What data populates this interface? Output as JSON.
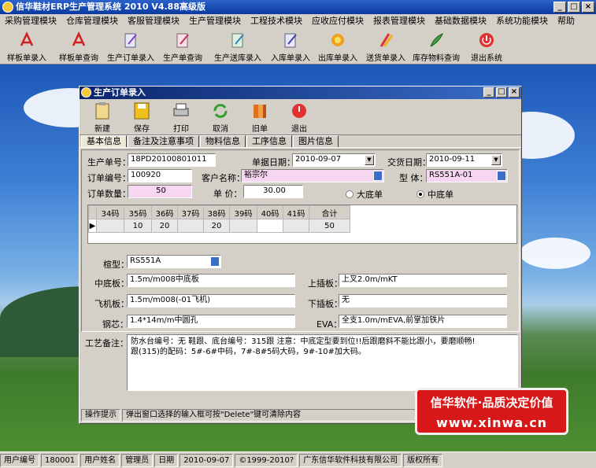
{
  "window": {
    "title": "信华鞋材ERP生产管理系统   2010  V4.88高级版"
  },
  "menu": [
    "采购管理模块",
    "仓库管理模块",
    "客服管理模块",
    "生产管理模块",
    "工程技术模块",
    "应收应付模块",
    "报表管理模块",
    "基础数据模块",
    "系统功能模块",
    "帮助"
  ],
  "toolbar": [
    "样板单录入",
    "样板单查询",
    "生产订单录入",
    "生产单查询",
    "生产送库录入",
    "入库单录入",
    "出库单录入",
    "送货单录入",
    "库存物料查询",
    "退出系统"
  ],
  "child": {
    "title": "生产订单录入",
    "toolbar": [
      "新建",
      "保存",
      "打印",
      "取消",
      "旧单",
      "退出"
    ],
    "tabs": [
      "基本信息",
      "备注及注意事项",
      "物料信息",
      "工序信息",
      "图片信息"
    ],
    "form": {
      "prod_no_label": "生产单号：",
      "prod_no": "18PD20100801011",
      "doc_date_label": "单据日期：",
      "doc_date": "2010-09-07",
      "delivery_label": "交货日期：",
      "delivery": "2010-09-11",
      "order_no_label": "订单编号：",
      "order_no": "100920",
      "customer_label": "客户名称：",
      "customer": "裕宗尔",
      "model_label": "型  体：",
      "model": "RS551A-01",
      "qty_label": "订单数量：",
      "qty": "50",
      "price_label": "单  价：",
      "price": "30.00",
      "radio1": "大底单",
      "radio2": "中底单"
    },
    "grid": {
      "headers": [
        "34码",
        "35码",
        "36码",
        "37码",
        "38码",
        "39码",
        "40码",
        "41码",
        "合计"
      ],
      "row": [
        "",
        "10",
        "20",
        "",
        "20",
        "",
        "",
        "",
        "50"
      ]
    },
    "detail": {
      "last_label": "楦型：",
      "last": "RS551A",
      "mid_label": "中底板：",
      "mid": "1.5m/m008中底板",
      "upper_label": "上插板：",
      "upper": "上叉2.0m/mKT",
      "fly_label": "飞机板：",
      "fly": "1.5m/m008(-01飞机)",
      "lower_label": "下插板：",
      "lower": "无",
      "steel_label": "钢芯：",
      "steel": "1.4*14m/m中圆孔",
      "eva_label": "EVA：",
      "eva": "全支1.0m/mEVA,前掌加铁片",
      "process_label": "工艺备注：",
      "process_line1": "防水台编号：无  鞋跟、底台编号：315跟  注意：中底定型要到位!!后跟磨斜不能比跟小，要磨顺畅!",
      "process_line2": "     跟(315)的配码：5#-6#中码，7#-8#5码大码，9#-10#加大码。"
    },
    "hint_label": "操作提示",
    "hint_text": "弹出窗口选择的输入框可按\"Delete\"键可清除内容"
  },
  "brand": {
    "line1": "信华软件·品质决定价值",
    "line2": "www.xinwa.cn"
  },
  "status": {
    "user_id_label": "用户编号",
    "user_id": "180001",
    "user_name_label": "用户姓名",
    "user_name": "管理员",
    "date_label": "日期",
    "date": "2010-09-07",
    "copyright": "©1999-2010?",
    "company": "广东信华软件科技有限公司",
    "rights": "版权所有"
  }
}
